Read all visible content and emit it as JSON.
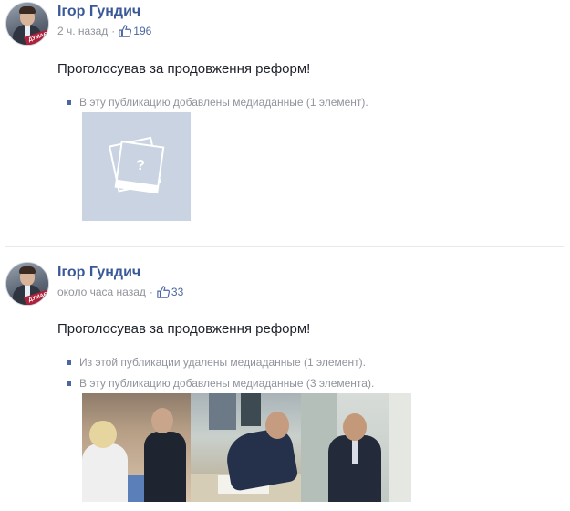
{
  "posts": [
    {
      "author": "Ігор Гундич",
      "avatar_badge": "ДУМАЄ",
      "time": "2 ч. назад",
      "separator": "·",
      "likes": "196",
      "message": "Проголосував за продовження реформ!",
      "notices": [
        "В эту публикацию добавлены медиаданные (1 элемент)."
      ],
      "media_placeholder_icon": "?"
    },
    {
      "author": "Ігор Гундич",
      "avatar_badge": "ДУМАЄ",
      "time": "около часа назад",
      "separator": "·",
      "likes": "33",
      "message": "Проголосував за продовження реформ!",
      "notices": [
        "Из этой публикации удалены медиаданные (1 элемент).",
        "В эту публикацию добавлены медиаданные (3 элемента)."
      ]
    }
  ],
  "colors": {
    "link": "#3b5998",
    "meta": "#90949c",
    "placeholder": "#c9d3e2",
    "bullet": "#4b67a1"
  }
}
